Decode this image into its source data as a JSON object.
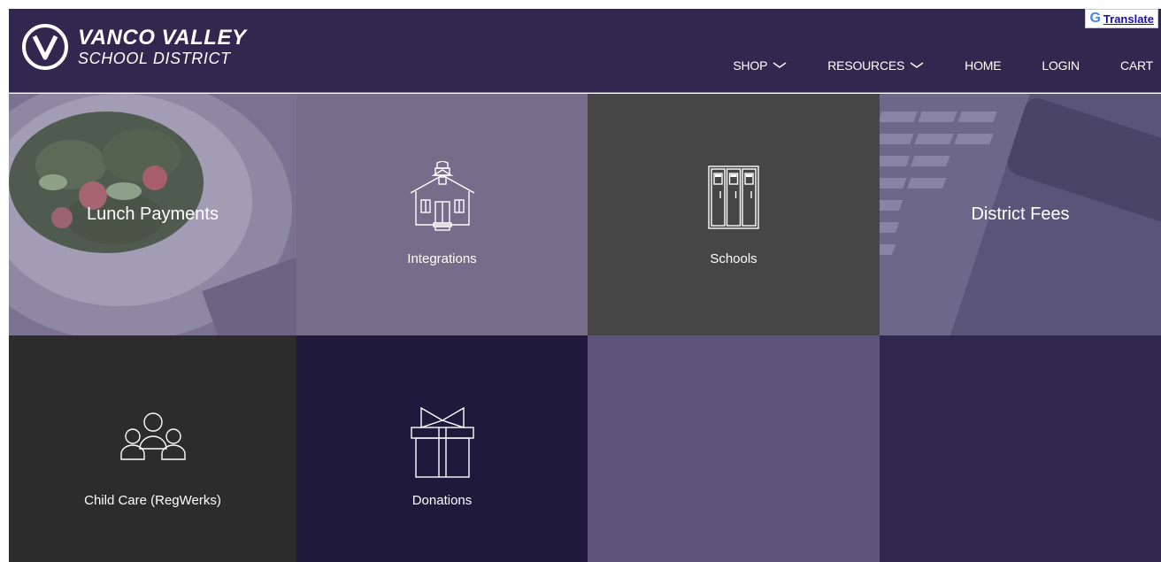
{
  "header": {
    "logo_line1": "VANCO VALLEY",
    "logo_line2": "SCHOOL DISTRICT",
    "translate_label": "Translate",
    "nav": {
      "shop": "SHOP",
      "resources": "RESOURCES",
      "home": "HOME",
      "login": "LOGIN",
      "cart": "CART"
    }
  },
  "tiles": [
    {
      "label": "Lunch Payments",
      "icon": "salad-photo"
    },
    {
      "label": "Integrations",
      "icon": "schoolhouse-icon"
    },
    {
      "label": "Schools",
      "icon": "lockers-icon"
    },
    {
      "label": "District Fees",
      "icon": "keyboard-photo"
    },
    {
      "label": "Child Care (RegWerks)",
      "icon": "people-group-icon"
    },
    {
      "label": "Donations",
      "icon": "gift-box-icon"
    }
  ],
  "colors": {
    "header_bg": "#30284f",
    "tile_purple_light": "#746e8a",
    "tile_gray": "#464646",
    "tile_dark": "#2c2c2c",
    "tile_navy": "#1f1a3c",
    "tile_purple_mid": "#5d547c"
  }
}
